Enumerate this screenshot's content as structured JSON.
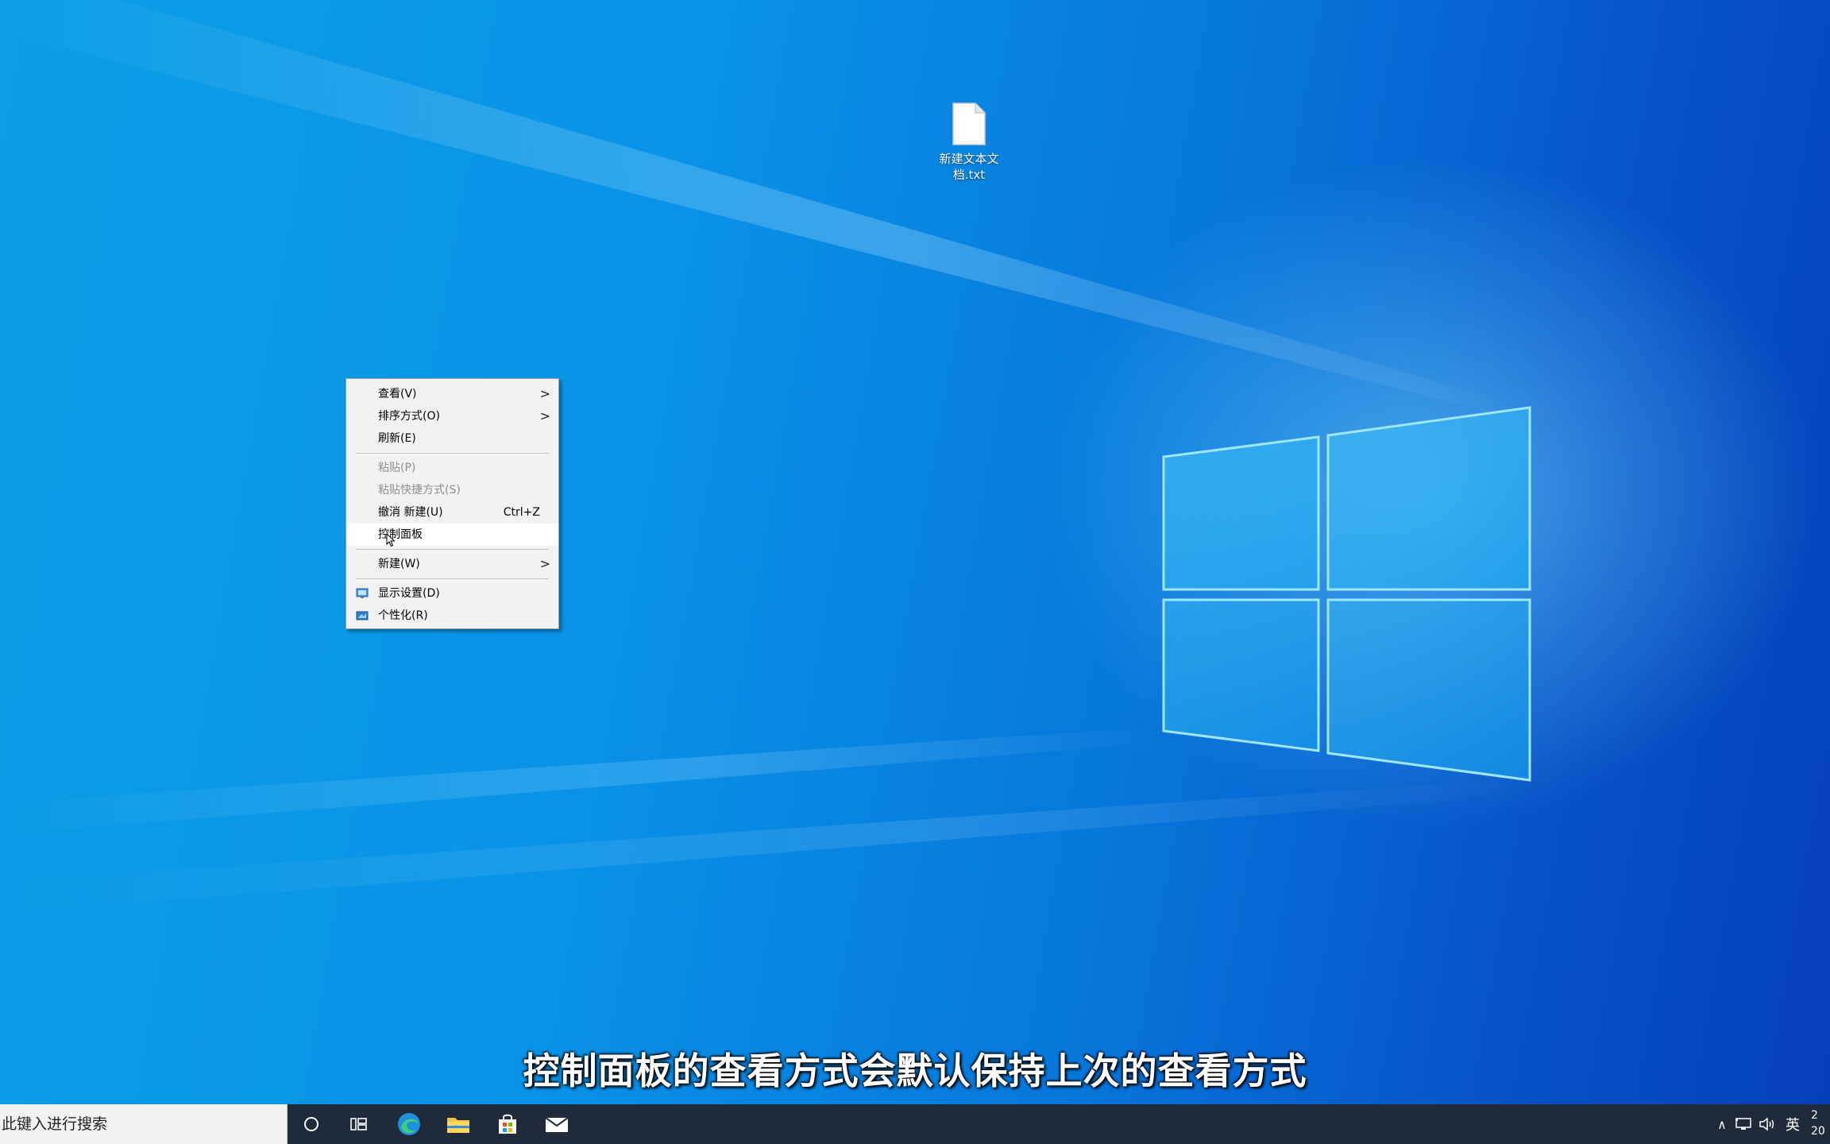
{
  "desktop": {
    "icons": [
      {
        "label": "新建文本文档.txt",
        "icon": "text-file-icon"
      }
    ]
  },
  "context_menu": {
    "items": [
      {
        "label": "查看(V)",
        "submenu": true
      },
      {
        "label": "排序方式(O)",
        "submenu": true
      },
      {
        "label": "刷新(E)"
      },
      {
        "label": "粘贴(P)",
        "disabled": true
      },
      {
        "label": "粘贴快捷方式(S)",
        "disabled": true
      },
      {
        "label": "撤消 新建(U)",
        "shortcut": "Ctrl+Z"
      },
      {
        "label": "控制面板",
        "hovered": true
      },
      {
        "label": "新建(W)",
        "submenu": true
      },
      {
        "label": "显示设置(D)",
        "icon": "display-settings-icon"
      },
      {
        "label": "个性化(R)",
        "icon": "personalize-icon"
      }
    ],
    "submenu_arrow": ">"
  },
  "subtitle": "控制面板的查看方式会默认保持上次的查看方式",
  "taskbar": {
    "search_placeholder": "在此键入进行搜索",
    "search_visible_text": "此键入进行搜索",
    "pinned": [
      {
        "name": "cortana-circle-icon"
      },
      {
        "name": "task-view-icon"
      },
      {
        "name": "edge-icon"
      },
      {
        "name": "file-explorer-icon"
      },
      {
        "name": "microsoft-store-icon"
      },
      {
        "name": "mail-icon"
      }
    ],
    "tray": {
      "chevron": "∧",
      "ime": "英",
      "clock_time_partial": "2",
      "clock_date_partial": "20"
    }
  },
  "colors": {
    "accent": "#0a78d7",
    "taskbar": "#1f2a3a",
    "menu_bg": "#f2f2f2"
  }
}
